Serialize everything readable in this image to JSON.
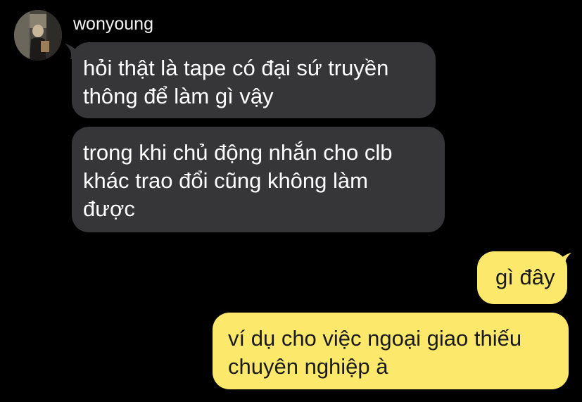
{
  "chat": {
    "sender": {
      "name": "wonyoung",
      "avatar_icon": "user-avatar-photo-icon"
    },
    "messages": [
      {
        "side": "incoming",
        "text_lines": [
          "hỏi thật là tape có đại sứ truyền",
          "thông để làm gì vậy"
        ]
      },
      {
        "side": "incoming",
        "text_lines": [
          "trong khi chủ động nhắn cho clb",
          "khác trao đổi cũng không làm",
          "được"
        ]
      },
      {
        "side": "outgoing",
        "text_lines": [
          "gì đây"
        ]
      },
      {
        "side": "outgoing",
        "text_lines": [
          "ví dụ cho việc ngoại giao thiếu",
          "chuyên nghiệp à"
        ]
      }
    ]
  },
  "colors": {
    "background": "#000000",
    "incoming_bubble": "#363638",
    "incoming_text": "#ffffff",
    "outgoing_bubble": "#fce86b",
    "outgoing_text": "#1a1a1a"
  }
}
